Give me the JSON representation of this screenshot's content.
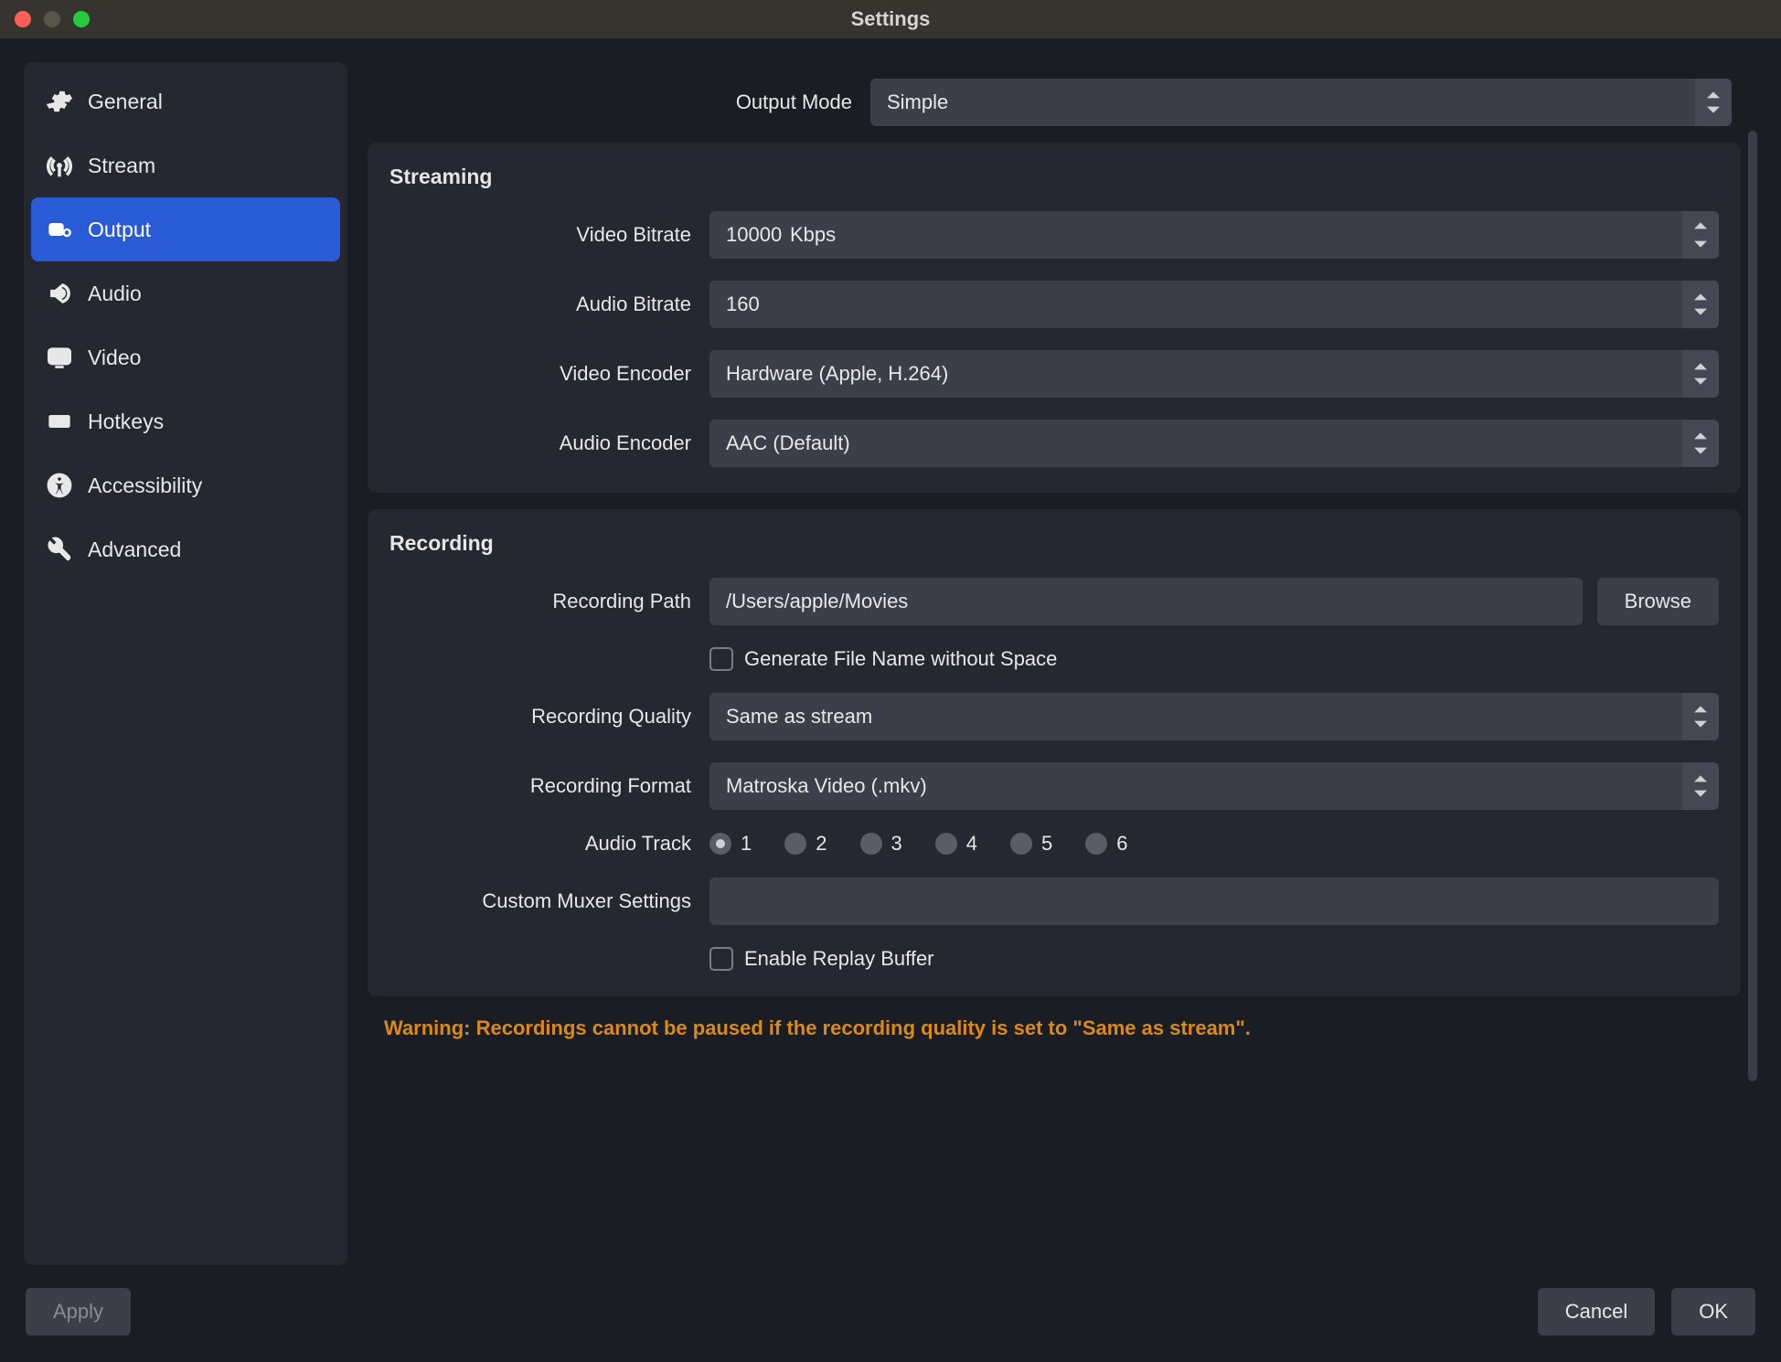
{
  "titlebar": {
    "title": "Settings"
  },
  "sidebar": {
    "items": [
      {
        "label": "General"
      },
      {
        "label": "Stream"
      },
      {
        "label": "Output"
      },
      {
        "label": "Audio"
      },
      {
        "label": "Video"
      },
      {
        "label": "Hotkeys"
      },
      {
        "label": "Accessibility"
      },
      {
        "label": "Advanced"
      }
    ],
    "selected_index": 2
  },
  "output_mode": {
    "label": "Output Mode",
    "value": "Simple"
  },
  "streaming": {
    "title": "Streaming",
    "video_bitrate": {
      "label": "Video Bitrate",
      "value": "10000",
      "unit": "Kbps"
    },
    "audio_bitrate": {
      "label": "Audio Bitrate",
      "value": "160"
    },
    "video_encoder": {
      "label": "Video Encoder",
      "value": "Hardware (Apple, H.264)"
    },
    "audio_encoder": {
      "label": "Audio Encoder",
      "value": "AAC (Default)"
    }
  },
  "recording": {
    "title": "Recording",
    "path": {
      "label": "Recording Path",
      "value": "/Users/apple/Movies",
      "browse": "Browse"
    },
    "gen_filename_no_space": {
      "label": "Generate File Name without Space",
      "checked": false
    },
    "quality": {
      "label": "Recording Quality",
      "value": "Same as stream"
    },
    "format": {
      "label": "Recording Format",
      "value": "Matroska Video (.mkv)"
    },
    "audio_track": {
      "label": "Audio Track",
      "options": [
        "1",
        "2",
        "3",
        "4",
        "5",
        "6"
      ],
      "selected_index": 0
    },
    "custom_muxer": {
      "label": "Custom Muxer Settings",
      "value": ""
    },
    "replay_buffer": {
      "label": "Enable Replay Buffer",
      "checked": false
    }
  },
  "warning": "Warning: Recordings cannot be paused if the recording quality is set to \"Same as stream\".",
  "buttons": {
    "apply": "Apply",
    "cancel": "Cancel",
    "ok": "OK"
  }
}
